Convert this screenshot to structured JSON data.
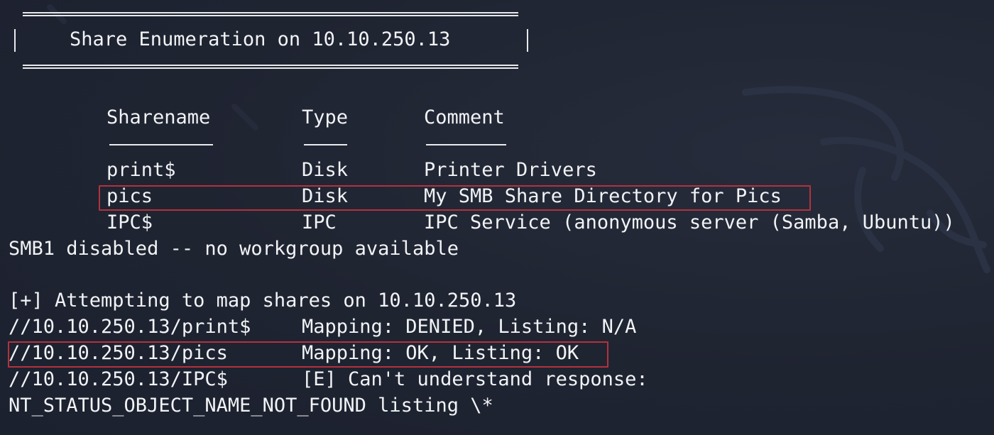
{
  "banner": {
    "title": "Share Enumeration on 10.10.250.13"
  },
  "share_table": {
    "headers": [
      "Sharename",
      "Type",
      "Comment"
    ],
    "rows": [
      {
        "name": "print$",
        "type": "Disk",
        "comment": "Printer Drivers"
      },
      {
        "name": "pics",
        "type": "Disk",
        "comment": "My SMB Share Directory for Pics"
      },
      {
        "name": "IPC$",
        "type": "IPC",
        "comment": "IPC Service (anonymous server (Samba, Ubuntu))"
      }
    ]
  },
  "smb1_line": "SMB1 disabled -- no workgroup available",
  "mapping": {
    "attempt_line": "[+] Attempting to map shares on 10.10.250.13",
    "rows": [
      {
        "path": "//10.10.250.13/print$",
        "result": "Mapping: DENIED, Listing: N/A"
      },
      {
        "path": "//10.10.250.13/pics",
        "result": "Mapping: OK, Listing: OK"
      },
      {
        "path": "//10.10.250.13/IPC$",
        "result": "[E] Can't understand response:"
      }
    ],
    "error_tail": "NT_STATUS_OBJECT_NAME_NOT_FOUND listing \\*"
  },
  "colors": {
    "background": "#1f2431",
    "text": "#f1f3f5",
    "highlight_box": "#b3323d"
  }
}
